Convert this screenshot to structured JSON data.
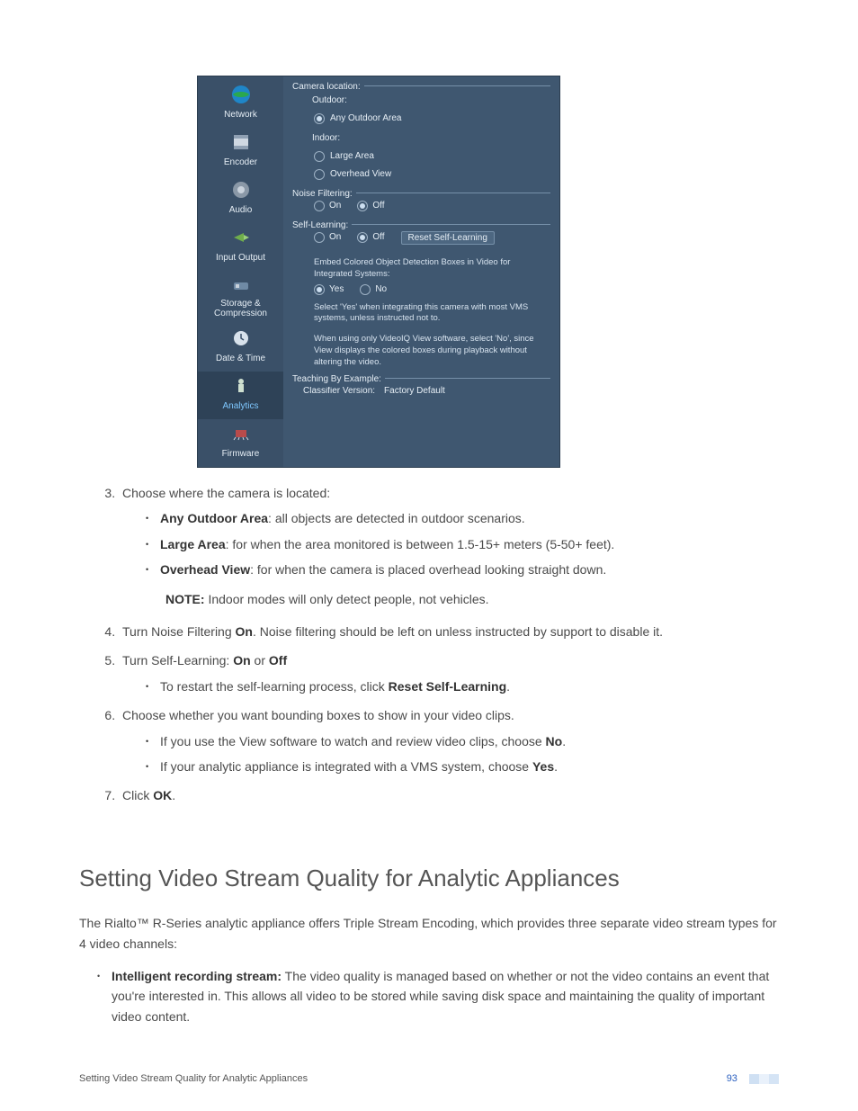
{
  "screenshot": {
    "sidebar": [
      {
        "label": "Network"
      },
      {
        "label": "Encoder"
      },
      {
        "label": "Audio"
      },
      {
        "label": "Input Output"
      },
      {
        "label": "Storage & Compression"
      },
      {
        "label": "Date & Time"
      },
      {
        "label": "Analytics"
      },
      {
        "label": "Firmware"
      }
    ],
    "camera_location": {
      "legend": "Camera location:",
      "outdoor_label": "Outdoor:",
      "outdoor_opt": "Any Outdoor Area",
      "indoor_label": "Indoor:",
      "large_area": "Large Area",
      "overhead": "Overhead View"
    },
    "noise": {
      "legend": "Noise Filtering:",
      "on": "On",
      "off": "Off"
    },
    "self_learning": {
      "legend": "Self-Learning:",
      "on": "On",
      "off": "Off",
      "reset_btn": "Reset Self-Learning"
    },
    "embed": {
      "line": "Embed Colored Object Detection Boxes in Video for Integrated Systems:",
      "yes": "Yes",
      "no": "No",
      "note1": "Select 'Yes' when integrating this camera with most VMS systems, unless instructed not to.",
      "note2": "When using only VideoIQ View software, select 'No', since View displays the colored boxes during playback without altering the video."
    },
    "teaching": {
      "legend": "Teaching By Example:",
      "classifier_label": "Classifier Version:",
      "classifier_value": "Factory Default"
    }
  },
  "list": {
    "item3": "Choose where the camera is located:",
    "item3_bullets": {
      "a_bold": "Any Outdoor Area",
      "a_rest": ": all objects are detected in outdoor scenarios.",
      "b_bold": "Large Area",
      "b_rest": ": for when the area monitored is between 1.5-15+ meters (5-50+ feet).",
      "c_bold": "Overhead View",
      "c_rest": ": for when the camera is placed overhead looking straight down."
    },
    "note_bold": "NOTE:",
    "note_rest": " Indoor modes will only detect people, not vehicles.",
    "item4_a": "Turn Noise Filtering ",
    "item4_b": "On",
    "item4_c": ". Noise filtering should be left on unless instructed by support to disable it.",
    "item5_a": "Turn Self-Learning: ",
    "item5_b": "On",
    "item5_c": " or ",
    "item5_d": "Off",
    "item5_bullet_a": "To restart the self-learning process, click ",
    "item5_bullet_b": "Reset Self-Learning",
    "item5_bullet_c": ".",
    "item6": "Choose whether you want bounding boxes to show in your video clips.",
    "item6_b1_a": "If you use the View software to watch and review video clips, choose ",
    "item6_b1_b": "No",
    "item6_b1_c": ".",
    "item6_b2_a": "If your analytic appliance is integrated with a VMS system, choose ",
    "item6_b2_b": "Yes",
    "item6_b2_c": ".",
    "item7_a": "Click ",
    "item7_b": "OK",
    "item7_c": "."
  },
  "section_heading": "Setting Video Stream Quality for Analytic Appliances",
  "section_para": "The Rialto™ R-Series analytic appliance offers Triple Stream Encoding, which provides three separate video stream types for 4 video channels:",
  "section_bullet_bold": "Intelligent recording stream:",
  "section_bullet_rest": " The video quality is managed based on whether or not the video contains an event that you're interested in. This allows all video to be stored while saving disk space and maintaining the quality of important video content.",
  "footer": {
    "left": "Setting Video Stream Quality for Analytic Appliances",
    "page": "93"
  }
}
